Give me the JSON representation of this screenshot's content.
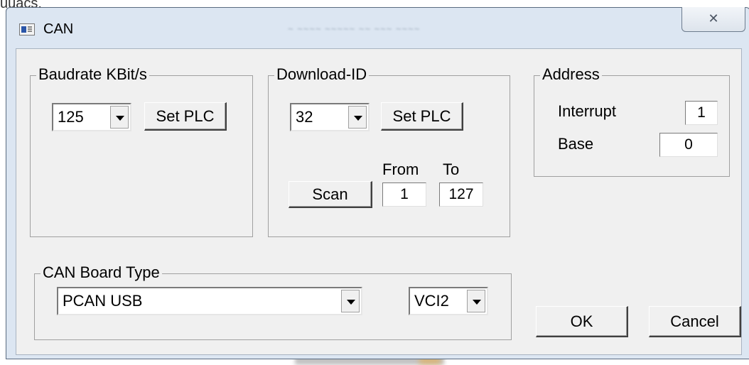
{
  "window": {
    "title": "CAN",
    "close_glyph": "✕",
    "app_icon": "can-app-icon"
  },
  "baudrate": {
    "group_label": "Baudrate KBit/s",
    "selected": "125",
    "set_button": "Set PLC"
  },
  "download_id": {
    "group_label": "Download-ID",
    "selected": "32",
    "set_button": "Set PLC",
    "scan_button": "Scan",
    "from_label": "From",
    "to_label": "To",
    "from_value": "1",
    "to_value": "127"
  },
  "address": {
    "group_label": "Address",
    "interrupt_label": "Interrupt",
    "interrupt_value": "1",
    "base_label": "Base",
    "base_value": "0"
  },
  "board": {
    "group_label": "CAN Board Type",
    "selected": "PCAN USB",
    "driver_selected": "VCI2"
  },
  "actions": {
    "ok": "OK",
    "cancel": "Cancel"
  }
}
